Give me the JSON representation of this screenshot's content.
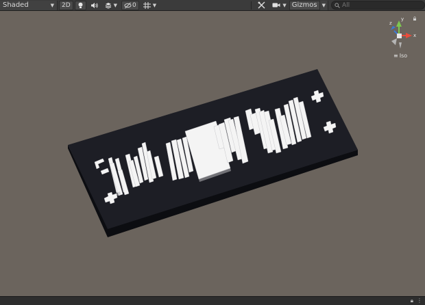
{
  "toolbar": {
    "shading_mode": "Shaded",
    "mode_2d": "2D",
    "fx_count": "0",
    "gizmos_label": "Gizmos",
    "search_placeholder": "All"
  },
  "gizmo": {
    "axis_y": "y",
    "axis_z": "z",
    "axis_x": "x",
    "projection_label": "Iso"
  },
  "colors": {
    "viewport_bg": "#6b645d",
    "plate_top": "#1c1d24",
    "plate_front": "#0c0d11",
    "glyph": "#f4f4f4",
    "axis_x": "#e74c3c",
    "axis_y": "#7ec850",
    "axis_z": "#3b7bd6"
  },
  "icons": [
    "light-bulb-icon",
    "audio-icon",
    "layers-icon",
    "fx-hidden-icon",
    "grid-icon",
    "tools-icon",
    "camera-icon",
    "search-icon",
    "lock-icon",
    "menu-dots-icon"
  ]
}
